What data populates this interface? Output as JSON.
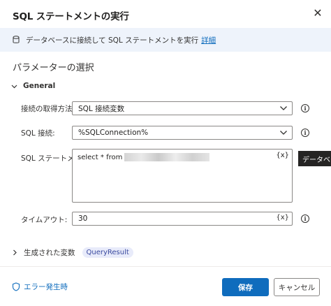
{
  "dialog": {
    "title": "SQL ステートメントの実行",
    "close_icon": "close-icon"
  },
  "banner": {
    "text": "データベースに接続して SQL ステートメントを実行",
    "link": "詳細"
  },
  "params": {
    "title": "パラメーターの選択",
    "group": "General"
  },
  "fields": {
    "method": {
      "label": "接続の取得方法:",
      "value": "SQL 接続変数"
    },
    "connection": {
      "label": "SQL 接続:",
      "value": "%SQLConnection%"
    },
    "statement": {
      "label": "SQL ステートメント:",
      "value": "select * from",
      "var": "{x}"
    },
    "timeout": {
      "label": "タイムアウト:",
      "value": "30",
      "var": "{x}"
    }
  },
  "tooltip": "データベース",
  "produced": {
    "label": "生成された変数",
    "variable": "QueryResult"
  },
  "footer": {
    "error": "エラー発生時",
    "save": "保存",
    "cancel": "キャンセル"
  },
  "colors": {
    "accent": "#0f6cbd",
    "banner_bg": "#eef3fb",
    "pill_bg": "#e8ebfa"
  }
}
